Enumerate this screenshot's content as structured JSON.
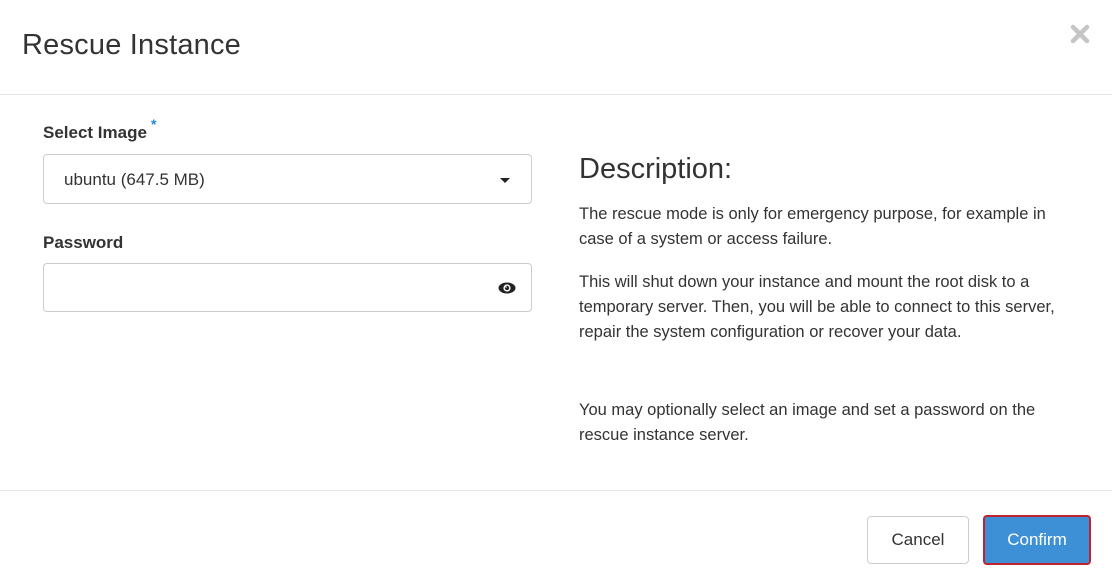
{
  "modal": {
    "title": "Rescue Instance",
    "close_icon": "close-icon"
  },
  "form": {
    "image_label": "Select Image",
    "required_marker": "*",
    "image_selected": "ubuntu (647.5 MB)",
    "password_label": "Password",
    "password_value": "",
    "password_placeholder": ""
  },
  "description": {
    "title": "Description:",
    "paragraphs": [
      "The rescue mode is only for emergency purpose, for example in case of a system or access failure.",
      "This will shut down your instance and mount the root disk to a temporary server. Then, you will be able to connect to this server, repair the system configuration or recover your data.",
      "You may optionally select an image and set a password on the rescue instance server."
    ]
  },
  "footer": {
    "cancel_label": "Cancel",
    "confirm_label": "Confirm"
  },
  "colors": {
    "primary": "#3d8fd6",
    "highlight_border": "#c0232d",
    "required": "#1e88e5"
  }
}
